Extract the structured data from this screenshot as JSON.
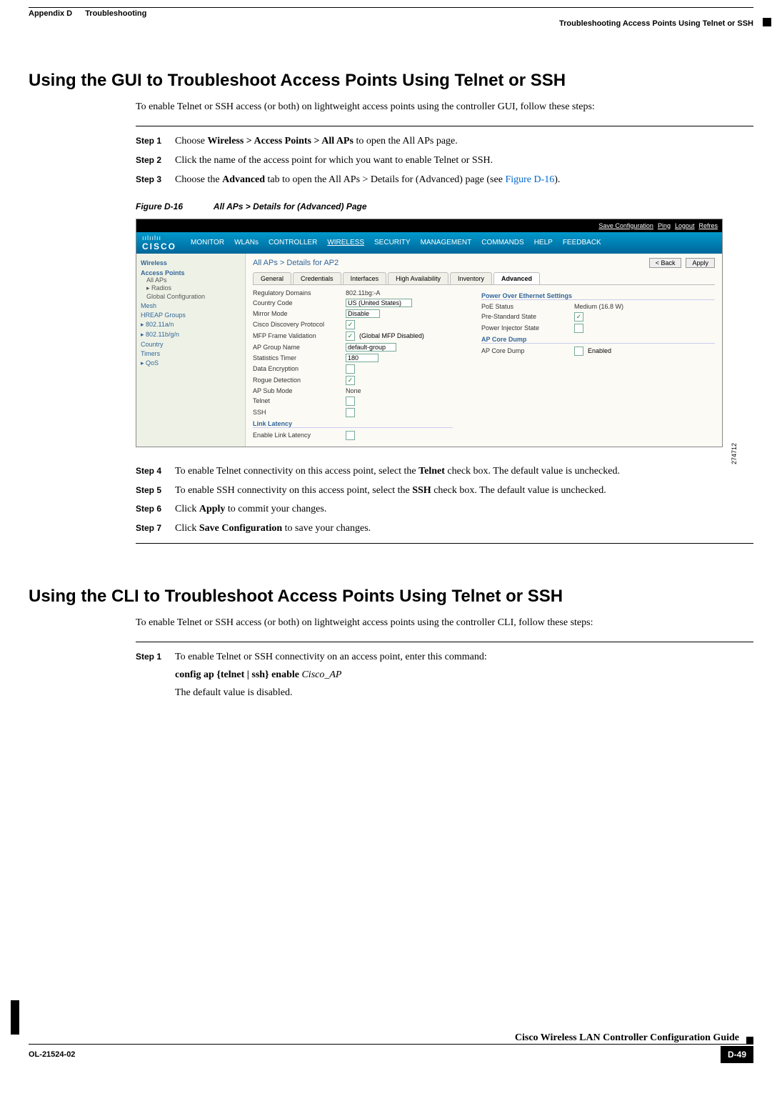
{
  "header": {
    "appendix": "Appendix D",
    "chapter": "Troubleshooting",
    "right": "Troubleshooting Access Points Using Telnet or SSH"
  },
  "section1": {
    "title": "Using the GUI to Troubleshoot Access Points Using Telnet or SSH",
    "intro": "To enable Telnet or SSH access (or both) on lightweight access points using the controller GUI, follow these steps:",
    "steps": [
      {
        "label": "Step 1",
        "pre": "Choose ",
        "bold": "Wireless > Access Points > All APs",
        "post": " to open the All APs page."
      },
      {
        "label": "Step 2",
        "pre": "Click the name of the access point for which you want to enable Telnet or SSH.",
        "bold": "",
        "post": ""
      },
      {
        "label": "Step 3",
        "pre": "Choose the ",
        "bold": "Advanced",
        "post": " tab to open the All APs > Details for (Advanced) page (see ",
        "link": "Figure D-16",
        "post2": ")."
      }
    ],
    "figure_caption_label": "Figure D-16",
    "figure_caption_title": "All APs > Details for (Advanced) Page",
    "steps2": [
      {
        "label": "Step 4",
        "pre": "To enable Telnet connectivity on this access point, select the ",
        "bold": "Telnet",
        "post": " check box. The default value is unchecked."
      },
      {
        "label": "Step 5",
        "pre": "To enable SSH connectivity on this access point, select the ",
        "bold": "SSH",
        "post": " check box. The default value is unchecked."
      },
      {
        "label": "Step 6",
        "pre": "Click ",
        "bold": "Apply",
        "post": " to commit your changes."
      },
      {
        "label": "Step 7",
        "pre": "Click ",
        "bold": "Save Configuration",
        "post": " to save your changes."
      }
    ]
  },
  "section2": {
    "title": "Using the CLI to Troubleshoot Access Points Using Telnet or SSH",
    "intro": "To enable Telnet or SSH access (or both) on lightweight access points using the controller CLI, follow these steps:",
    "step1_label": "Step 1",
    "step1_text": "To enable Telnet or SSH connectivity on an access point, enter this command:",
    "step1_cmd_bold": "config ap {telnet | ssh} enable ",
    "step1_cmd_italic": "Cisco_AP",
    "step1_note": "The default value is disabled."
  },
  "figure": {
    "top_links": [
      "Save Configuration",
      "Ping",
      "Logout",
      "Refres"
    ],
    "logo": "CISCO",
    "logo_bars": "ıılıılıı",
    "menus": [
      "MONITOR",
      "WLANs",
      "CONTROLLER",
      "WIRELESS",
      "SECURITY",
      "MANAGEMENT",
      "COMMANDS",
      "HELP",
      "FEEDBACK"
    ],
    "sidebar_title": "Wireless",
    "sidebar": [
      {
        "type": "h",
        "text": "Access Points"
      },
      {
        "type": "item",
        "text": "All APs"
      },
      {
        "type": "item",
        "text": "▸ Radios"
      },
      {
        "type": "item",
        "text": "Global Configuration"
      },
      {
        "type": "link",
        "text": "Mesh"
      },
      {
        "type": "link",
        "text": "HREAP Groups"
      },
      {
        "type": "link",
        "text": "▸ 802.11a/n"
      },
      {
        "type": "link",
        "text": "▸ 802.11b/g/n"
      },
      {
        "type": "link",
        "text": "Country"
      },
      {
        "type": "link",
        "text": "Timers"
      },
      {
        "type": "link",
        "text": "▸ QoS"
      }
    ],
    "breadcrumb": "All APs > Details for AP2",
    "btn_back": "< Back",
    "btn_apply": "Apply",
    "tabs": [
      "General",
      "Credentials",
      "Interfaces",
      "High Availability",
      "Inventory",
      "Advanced"
    ],
    "active_tab": 5,
    "col1": [
      {
        "lbl": "Regulatory Domains",
        "val": "802.11bg:-A"
      },
      {
        "lbl": "Country Code",
        "select": "US (United States)"
      },
      {
        "lbl": "Mirror Mode",
        "select": "Disable"
      },
      {
        "lbl": "Cisco Discovery Protocol",
        "check": true
      },
      {
        "lbl": "MFP Frame Validation",
        "check": true,
        "extra": "(Global MFP Disabled)"
      },
      {
        "lbl": "AP Group Name",
        "select": "default-group"
      },
      {
        "lbl": "Statistics Timer",
        "input": "180"
      },
      {
        "lbl": "Data Encryption",
        "check": false
      },
      {
        "lbl": "Rogue Detection",
        "check": true
      },
      {
        "lbl": "AP Sub Mode",
        "val": "None"
      },
      {
        "lbl": "Telnet",
        "check": false
      },
      {
        "lbl": "SSH",
        "check": false
      }
    ],
    "col1_section": "Link Latency",
    "col1_extra": {
      "lbl": "Enable Link Latency",
      "check": false
    },
    "col2_section1": "Power Over Ethernet Settings",
    "col2a": [
      {
        "lbl": "PoE Status",
        "val": "Medium (16.8 W)"
      },
      {
        "lbl": "Pre-Standard State",
        "check": true
      },
      {
        "lbl": "Power Injector State",
        "check": false
      }
    ],
    "col2_section2": "AP Core Dump",
    "col2b": [
      {
        "lbl": "AP Core Dump",
        "check": false,
        "extra": "Enabled"
      }
    ],
    "image_number": "274712"
  },
  "footer": {
    "doc_id": "OL-21524-02",
    "guide": "Cisco Wireless LAN Controller Configuration Guide",
    "page": "D-49"
  }
}
